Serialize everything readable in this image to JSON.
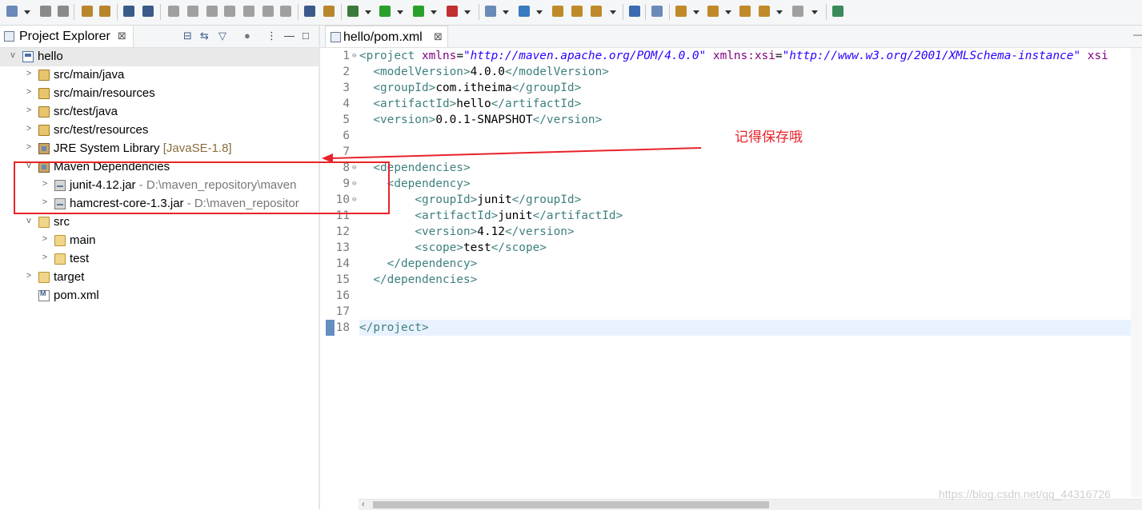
{
  "project_explorer": {
    "title": "Project Explorer",
    "close_glyph": "⊠",
    "toolbar_icons": [
      "collapse-all-icon",
      "link-editor-icon",
      "filter-icon",
      "gears-icon",
      "view-menu-icon",
      "minimize-icon",
      "maximize-icon"
    ]
  },
  "tree": [
    {
      "label": "hello",
      "decoration": "",
      "path": "",
      "icon": "project-icon",
      "indent": 0,
      "twisty": "v"
    },
    {
      "label": "src/main/java",
      "decoration": "",
      "path": "",
      "icon": "package-folder-icon",
      "indent": 1,
      "twisty": ">"
    },
    {
      "label": "src/main/resources",
      "decoration": "",
      "path": "",
      "icon": "package-folder-icon",
      "indent": 1,
      "twisty": ">"
    },
    {
      "label": "src/test/java",
      "decoration": "",
      "path": "",
      "icon": "package-folder-icon",
      "indent": 1,
      "twisty": ">"
    },
    {
      "label": "src/test/resources",
      "decoration": "",
      "path": "",
      "icon": "package-folder-icon",
      "indent": 1,
      "twisty": ">"
    },
    {
      "label": "JRE System Library",
      "decoration": "[JavaSE-1.8]",
      "path": "",
      "icon": "library-icon",
      "indent": 1,
      "twisty": ">"
    },
    {
      "label": "Maven Dependencies",
      "decoration": "",
      "path": "",
      "icon": "library-icon",
      "indent": 1,
      "twisty": "v"
    },
    {
      "label": "junit-4.12.jar",
      "decoration": "",
      "path": "- D:\\maven_repository\\maven",
      "icon": "jar-icon",
      "indent": 2,
      "twisty": ">"
    },
    {
      "label": "hamcrest-core-1.3.jar",
      "decoration": "",
      "path": "- D:\\maven_repositor",
      "icon": "jar-icon",
      "indent": 2,
      "twisty": ">"
    },
    {
      "label": "src",
      "decoration": "",
      "path": "",
      "icon": "folder-icon",
      "indent": 1,
      "twisty": "v"
    },
    {
      "label": "main",
      "decoration": "",
      "path": "",
      "icon": "folder-icon",
      "indent": 2,
      "twisty": ">"
    },
    {
      "label": "test",
      "decoration": "",
      "path": "",
      "icon": "folder-icon",
      "indent": 2,
      "twisty": ">"
    },
    {
      "label": "target",
      "decoration": "",
      "path": "",
      "icon": "folder-icon",
      "indent": 1,
      "twisty": ">"
    },
    {
      "label": "pom.xml",
      "decoration": "",
      "path": "",
      "icon": "xml-file-icon",
      "indent": 1,
      "twisty": ""
    }
  ],
  "editor": {
    "tab_title": "hello/pom.xml",
    "close_glyph": "⊠",
    "current_line": 18,
    "lines": [
      {
        "n": "1",
        "fold": "⊖",
        "tokens": [
          [
            "tag",
            "<project "
          ],
          [
            "attr",
            "xmlns"
          ],
          [
            "txt",
            "="
          ],
          [
            "str",
            "\"http://maven.apache.org/POM/4.0.0\""
          ],
          [
            "txt",
            " "
          ],
          [
            "attr",
            "xmlns:xsi"
          ],
          [
            "txt",
            "="
          ],
          [
            "str",
            "\"http://www.w3.org/2001/XMLSchema-instance\""
          ],
          [
            "txt",
            " "
          ],
          [
            "attr",
            "xsi"
          ]
        ]
      },
      {
        "n": "2",
        "fold": "",
        "tokens": [
          [
            "txt",
            "  "
          ],
          [
            "tag",
            "<modelVersion>"
          ],
          [
            "txt",
            "4.0.0"
          ],
          [
            "tag",
            "</modelVersion>"
          ]
        ]
      },
      {
        "n": "3",
        "fold": "",
        "tokens": [
          [
            "txt",
            "  "
          ],
          [
            "tag",
            "<groupId>"
          ],
          [
            "txt",
            "com.itheima"
          ],
          [
            "tag",
            "</groupId>"
          ]
        ]
      },
      {
        "n": "4",
        "fold": "",
        "tokens": [
          [
            "txt",
            "  "
          ],
          [
            "tag",
            "<artifactId>"
          ],
          [
            "txt",
            "hello"
          ],
          [
            "tag",
            "</artifactId>"
          ]
        ]
      },
      {
        "n": "5",
        "fold": "",
        "tokens": [
          [
            "txt",
            "  "
          ],
          [
            "tag",
            "<version>"
          ],
          [
            "txt",
            "0.0.1-SNAPSHOT"
          ],
          [
            "tag",
            "</version>"
          ]
        ]
      },
      {
        "n": "6",
        "fold": "",
        "tokens": []
      },
      {
        "n": "7",
        "fold": "",
        "tokens": []
      },
      {
        "n": "8",
        "fold": "⊖",
        "tokens": [
          [
            "txt",
            "  "
          ],
          [
            "tag",
            "<dependencies>"
          ]
        ]
      },
      {
        "n": "9",
        "fold": "⊖",
        "tokens": [
          [
            "txt",
            "    "
          ],
          [
            "tag",
            "<dependency>"
          ]
        ]
      },
      {
        "n": "10",
        "fold": "⊖",
        "tokens": [
          [
            "txt",
            "        "
          ],
          [
            "tag",
            "<groupId>"
          ],
          [
            "txt",
            "junit"
          ],
          [
            "tag",
            "</groupId>"
          ]
        ]
      },
      {
        "n": "11",
        "fold": "",
        "tokens": [
          [
            "txt",
            "        "
          ],
          [
            "tag",
            "<artifactId>"
          ],
          [
            "txt",
            "junit"
          ],
          [
            "tag",
            "</artifactId>"
          ]
        ]
      },
      {
        "n": "12",
        "fold": "",
        "tokens": [
          [
            "txt",
            "        "
          ],
          [
            "tag",
            "<version>"
          ],
          [
            "txt",
            "4.12"
          ],
          [
            "tag",
            "</version>"
          ]
        ]
      },
      {
        "n": "13",
        "fold": "",
        "tokens": [
          [
            "txt",
            "        "
          ],
          [
            "tag",
            "<scope>"
          ],
          [
            "txt",
            "test"
          ],
          [
            "tag",
            "</scope>"
          ]
        ]
      },
      {
        "n": "14",
        "fold": "",
        "tokens": [
          [
            "txt",
            "    "
          ],
          [
            "tag",
            "</dependency>"
          ]
        ]
      },
      {
        "n": "15",
        "fold": "",
        "tokens": [
          [
            "txt",
            "  "
          ],
          [
            "tag",
            "</dependencies>"
          ]
        ]
      },
      {
        "n": "16",
        "fold": "",
        "tokens": []
      },
      {
        "n": "17",
        "fold": "",
        "tokens": []
      },
      {
        "n": "18",
        "fold": "",
        "tokens": [
          [
            "tag",
            "</project>"
          ]
        ]
      }
    ]
  },
  "annotation": {
    "text": "记得保存哦",
    "color": "#e8232a"
  },
  "watermark": "https://blog.csdn.net/qq_44316726",
  "colors": {
    "tag": "#3f7f7f",
    "attr": "#7f007f",
    "string": "#2a00ff",
    "annotation": "#e8232a",
    "current_line": "#e8f2fe"
  }
}
